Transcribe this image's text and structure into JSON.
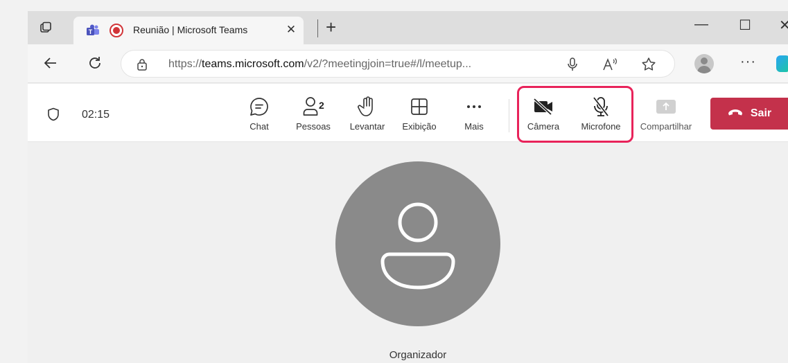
{
  "browser": {
    "tab": {
      "title": "Reunião | Microsoft Teams",
      "close_glyph": "✕"
    },
    "new_tab_glyph": "+",
    "window_controls": {
      "minimize": "—",
      "maximize": "☐",
      "close": "✕"
    },
    "address": {
      "url_prefix": "https://",
      "url_domain": "teams.microsoft.com",
      "url_path": "/v2/?meetingjoin=true#/l/meetup..."
    },
    "more_glyph": "···"
  },
  "meeting": {
    "timer": "02:15",
    "controls": [
      {
        "id": "chat",
        "label": "Chat",
        "icon": "chat-icon"
      },
      {
        "id": "people",
        "label": "Pessoas",
        "icon": "people-icon",
        "count": "2"
      },
      {
        "id": "raise",
        "label": "Levantar",
        "icon": "raise-hand-icon"
      },
      {
        "id": "view",
        "label": "Exibição",
        "icon": "grid-view-icon"
      },
      {
        "id": "more",
        "label": "Mais",
        "icon": "more-icon"
      },
      {
        "id": "camera",
        "label": "Câmera",
        "icon": "camera-off-icon"
      },
      {
        "id": "mic",
        "label": "Microfone",
        "icon": "mic-off-icon"
      },
      {
        "id": "share",
        "label": "Compartilhar",
        "icon": "share-icon"
      }
    ],
    "leave_label": "Sair",
    "participant": {
      "name": "Organizador"
    }
  },
  "colors": {
    "leave": "#c4314b",
    "highlight": "#e8235a",
    "recording": "#d13438",
    "avatar": "#8a8a8a"
  }
}
